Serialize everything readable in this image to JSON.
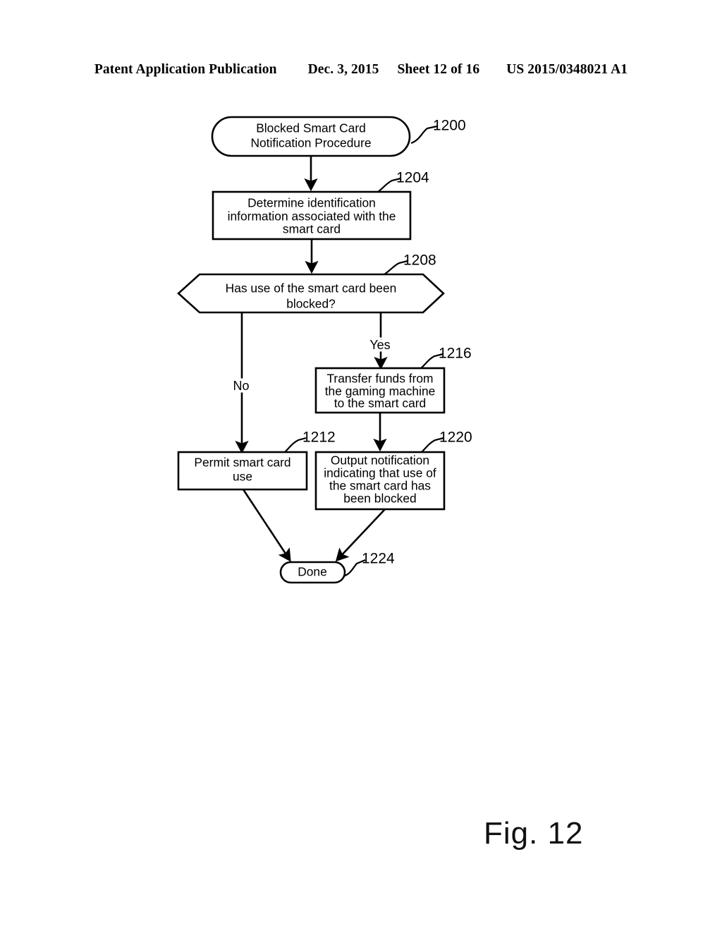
{
  "header": {
    "publication": "Patent Application Publication",
    "date": "Dec. 3, 2015",
    "sheet": "Sheet 12 of 16",
    "patent_number": "US 2015/0348021 A1"
  },
  "figure": {
    "caption": "Fig. 12"
  },
  "flowchart": {
    "nodes": [
      {
        "id": "start",
        "ref": "1200",
        "shape": "rounded-terminal",
        "lines": [
          "Blocked Smart Card",
          "Notification Procedure"
        ]
      },
      {
        "id": "determine",
        "ref": "1204",
        "shape": "rectangle",
        "lines": [
          "Determine identification",
          "information associated with the",
          "smart card"
        ]
      },
      {
        "id": "decision",
        "ref": "1208",
        "shape": "hexagon",
        "lines": [
          "Has use of the smart card been",
          "blocked?"
        ]
      },
      {
        "id": "transfer",
        "ref": "1216",
        "shape": "rectangle",
        "lines": [
          "Transfer funds from",
          "the gaming machine",
          "to the smart card"
        ]
      },
      {
        "id": "permit",
        "ref": "1212",
        "shape": "rectangle",
        "lines": [
          "Permit smart card",
          "use"
        ]
      },
      {
        "id": "output",
        "ref": "1220",
        "shape": "rectangle",
        "lines": [
          "Output notification",
          "indicating that use of",
          "the smart card has",
          "been blocked"
        ]
      },
      {
        "id": "done",
        "ref": "1224",
        "shape": "rounded-terminal",
        "lines": [
          "Done"
        ]
      }
    ],
    "branch_labels": {
      "yes": "Yes",
      "no": "No"
    }
  }
}
